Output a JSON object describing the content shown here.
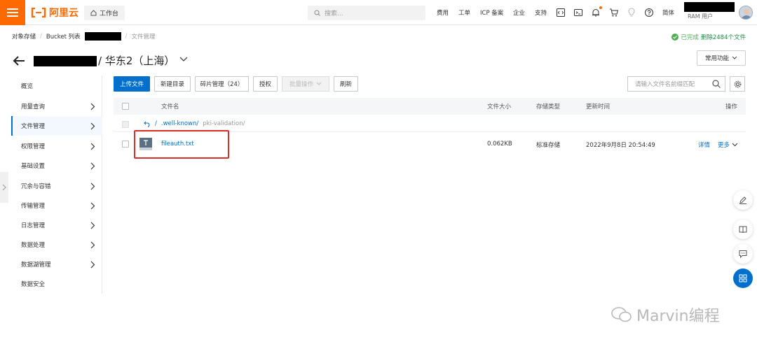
{
  "header": {
    "logo_text": "阿里云",
    "workbench_label": "工作台",
    "search_placeholder": "搜索...",
    "nav": [
      "费用",
      "工单",
      "ICP 备案",
      "企业",
      "支持"
    ],
    "lang_label": "简体",
    "user_role": "RAM 用户",
    "brand_color": "#ff6a00"
  },
  "breadcrumb": {
    "items": [
      "对象存储",
      "Bucket 列表"
    ],
    "current": "文件管理"
  },
  "status": {
    "done": "已完成",
    "deleted": "删除2484个文件",
    "color": "#4caf50"
  },
  "title": {
    "region": "/ 华东2（上海）",
    "common_functions": "常用功能"
  },
  "sidebar": {
    "items": [
      {
        "label": "概览",
        "has_chevron": false
      },
      {
        "label": "用量查询",
        "has_chevron": true
      },
      {
        "label": "文件管理",
        "has_chevron": true,
        "active": true
      },
      {
        "label": "权限管理",
        "has_chevron": true
      },
      {
        "label": "基础设置",
        "has_chevron": true
      },
      {
        "label": "冗余与容错",
        "has_chevron": true
      },
      {
        "label": "传输管理",
        "has_chevron": true
      },
      {
        "label": "日志管理",
        "has_chevron": true
      },
      {
        "label": "数据处理",
        "has_chevron": true
      },
      {
        "label": "数据湖管理",
        "has_chevron": true
      },
      {
        "label": "数据安全",
        "has_chevron": false
      }
    ]
  },
  "toolbar": {
    "upload": "上传文件",
    "new_dir": "新建目录",
    "fragments": "碎片管理（24）",
    "authorize": "授权",
    "batch": "批量操作",
    "refresh": "刷新",
    "search_placeholder": "请输入文件名前缀匹配",
    "accent": "#0070cc"
  },
  "table": {
    "headers": {
      "name": "文件名",
      "size": "文件大小",
      "storage": "存储类型",
      "updated": "更新时间",
      "actions": "操作"
    },
    "path": {
      "root": "/",
      "dir": ".well-known/",
      "subdir": "pki-validation/"
    },
    "rows": [
      {
        "name": "fileauth.txt",
        "size": "0.062KB",
        "storage": "标准存储",
        "updated": "2022年9月8日 20:54:49",
        "detail": "详情",
        "more": "更多"
      }
    ]
  },
  "watermark": "Marvin编程"
}
